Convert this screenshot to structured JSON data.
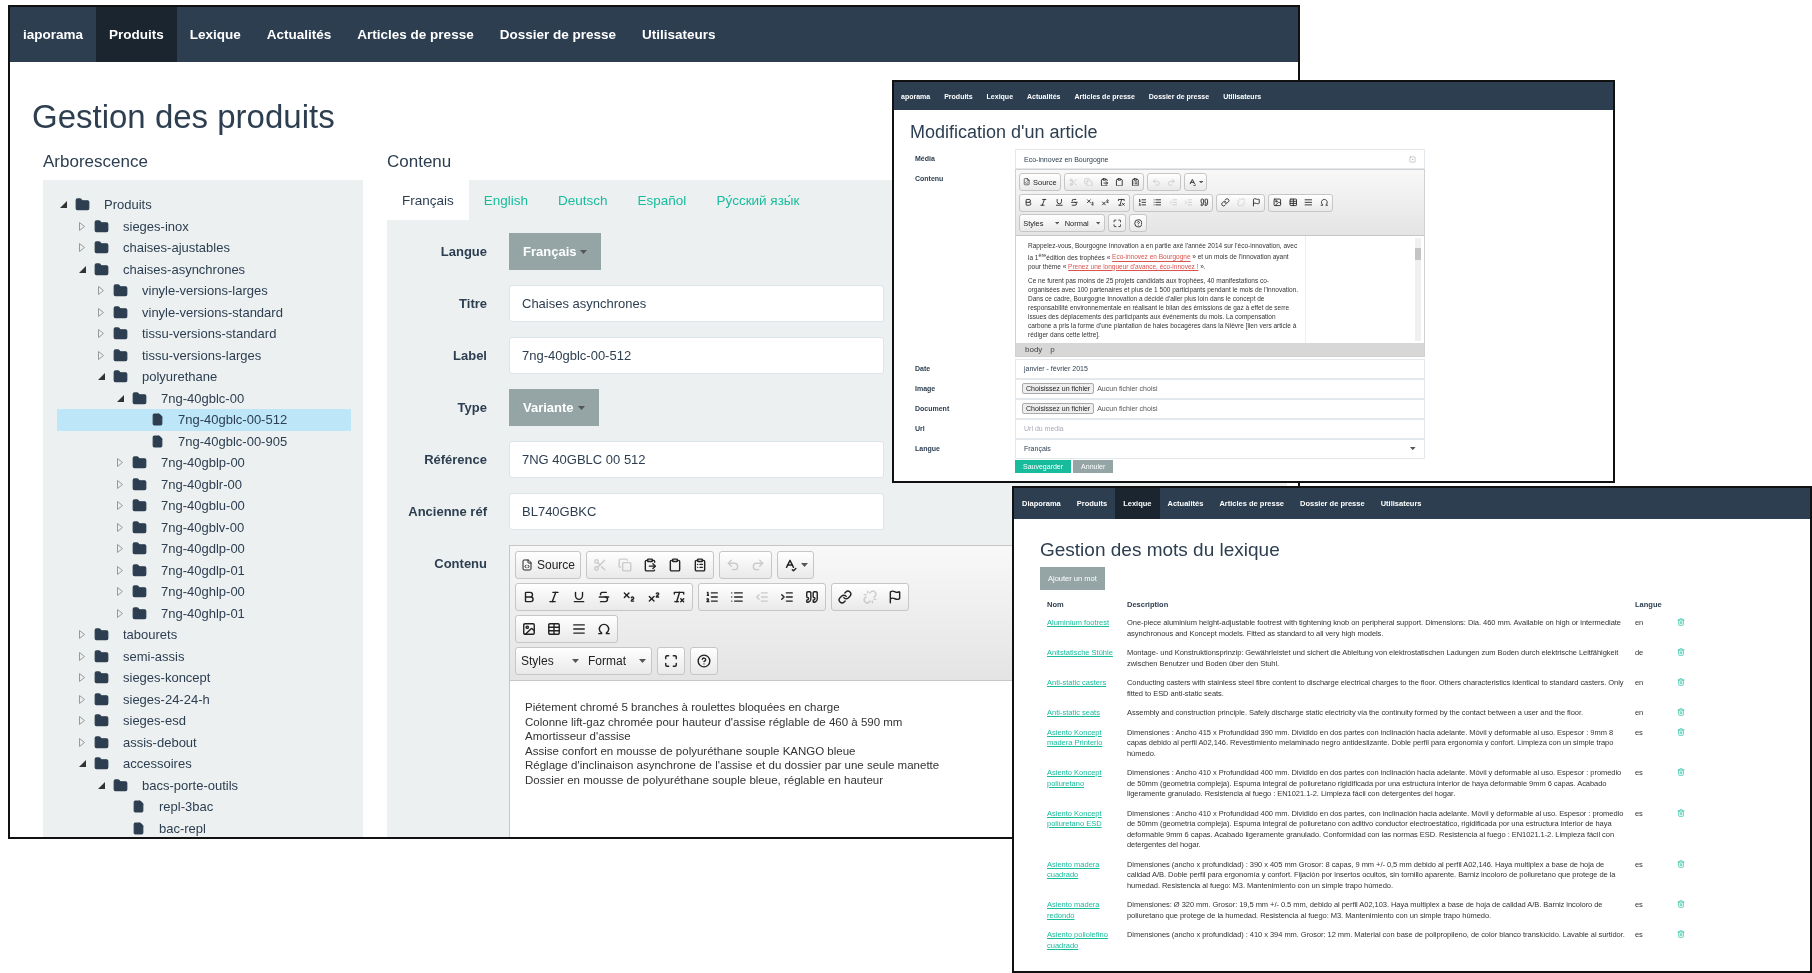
{
  "products_window": {
    "nav": [
      {
        "label": "iaporama",
        "selected": false
      },
      {
        "label": "Produits",
        "selected": true
      },
      {
        "label": "Lexique",
        "selected": false
      },
      {
        "label": "Actualités",
        "selected": false
      },
      {
        "label": "Articles de presse",
        "selected": false
      },
      {
        "label": "Dossier de presse",
        "selected": false
      },
      {
        "label": "Utilisateurs",
        "selected": false
      }
    ],
    "title": "Gestion des produits",
    "tree_heading": "Arborescence",
    "tree": [
      {
        "label": "Produits",
        "kind": "folder",
        "expanded": true,
        "selected": false,
        "children": [
          {
            "label": "sieges-inox",
            "kind": "folder",
            "expanded": false,
            "selected": false
          },
          {
            "label": "chaises-ajustables",
            "kind": "folder",
            "expanded": false,
            "selected": false
          },
          {
            "label": "chaises-asynchrones",
            "kind": "folder",
            "expanded": true,
            "selected": false,
            "children": [
              {
                "label": "vinyle-versions-larges",
                "kind": "folder",
                "expanded": false,
                "selected": false
              },
              {
                "label": "vinyle-versions-standard",
                "kind": "folder",
                "expanded": false,
                "selected": false
              },
              {
                "label": "tissu-versions-standard",
                "kind": "folder",
                "expanded": false,
                "selected": false
              },
              {
                "label": "tissu-versions-larges",
                "kind": "folder",
                "expanded": false,
                "selected": false
              },
              {
                "label": "polyurethane",
                "kind": "folder",
                "expanded": true,
                "selected": false,
                "children": [
                  {
                    "label": "7ng-40gblc-00",
                    "kind": "folder",
                    "expanded": true,
                    "selected": false,
                    "children": [
                      {
                        "label": "7ng-40gblc-00-512",
                        "kind": "file",
                        "selected": true
                      },
                      {
                        "label": "7ng-40gblc-00-905",
                        "kind": "file",
                        "selected": false
                      }
                    ]
                  },
                  {
                    "label": "7ng-40gblp-00",
                    "kind": "folder",
                    "expanded": false,
                    "selected": false
                  },
                  {
                    "label": "7ng-40gblr-00",
                    "kind": "folder",
                    "expanded": false,
                    "selected": false
                  },
                  {
                    "label": "7ng-40gblu-00",
                    "kind": "folder",
                    "expanded": false,
                    "selected": false
                  },
                  {
                    "label": "7ng-40gblv-00",
                    "kind": "folder",
                    "expanded": false,
                    "selected": false
                  },
                  {
                    "label": "7ng-40gdlp-00",
                    "kind": "folder",
                    "expanded": false,
                    "selected": false
                  },
                  {
                    "label": "7ng-40gdlp-01",
                    "kind": "folder",
                    "expanded": false,
                    "selected": false
                  },
                  {
                    "label": "7ng-40ghlp-00",
                    "kind": "folder",
                    "expanded": false,
                    "selected": false
                  },
                  {
                    "label": "7ng-40ghlp-01",
                    "kind": "folder",
                    "expanded": false,
                    "selected": false
                  }
                ]
              }
            ]
          },
          {
            "label": "tabourets",
            "kind": "folder",
            "expanded": false,
            "selected": false
          },
          {
            "label": "semi-assis",
            "kind": "folder",
            "expanded": false,
            "selected": false
          },
          {
            "label": "sieges-koncept",
            "kind": "folder",
            "expanded": false,
            "selected": false
          },
          {
            "label": "sieges-24-24-h",
            "kind": "folder",
            "expanded": false,
            "selected": false
          },
          {
            "label": "sieges-esd",
            "kind": "folder",
            "expanded": false,
            "selected": false
          },
          {
            "label": "assis-debout",
            "kind": "folder",
            "expanded": false,
            "selected": false
          },
          {
            "label": "accessoires",
            "kind": "folder",
            "expanded": true,
            "selected": false,
            "children": [
              {
                "label": "bacs-porte-outils",
                "kind": "folder",
                "expanded": true,
                "selected": false,
                "children": [
                  {
                    "label": "repl-3bac",
                    "kind": "file",
                    "selected": false
                  },
                  {
                    "label": "bac-repl",
                    "kind": "file",
                    "selected": false
                  }
                ]
              }
            ]
          }
        ]
      }
    ],
    "content_heading": "Contenu",
    "lang_tabs": [
      {
        "label": "Français",
        "selected": true
      },
      {
        "label": "English",
        "selected": false
      },
      {
        "label": "Deutsch",
        "selected": false
      },
      {
        "label": "Español",
        "selected": false
      },
      {
        "label": "Ру́сский язы́к",
        "selected": false
      }
    ],
    "fields": [
      {
        "label": "Langue",
        "kind": "dropdown",
        "value": "Français"
      },
      {
        "label": "Titre",
        "kind": "input",
        "value": "Chaises asynchrones"
      },
      {
        "label": "Label",
        "kind": "input",
        "value": "7ng-40gblc-00-512"
      },
      {
        "label": "Type",
        "kind": "dropdown",
        "value": "Variante"
      },
      {
        "label": "Référence",
        "kind": "input",
        "value": "7NG 40GBLC 00 512"
      },
      {
        "label": "Ancienne réf",
        "kind": "input",
        "value": "BL740GBKC"
      },
      {
        "label": "Contenu",
        "kind": "editor"
      }
    ],
    "editor": {
      "toolbar": [
        [
          [
            {
              "kind": "source",
              "label": "Source",
              "disabled": false
            }
          ],
          [
            {
              "kind": "cut",
              "disabled": true
            },
            {
              "kind": "copy",
              "disabled": true
            },
            {
              "kind": "paste",
              "disabled": false
            },
            {
              "kind": "paste-text",
              "disabled": false
            },
            {
              "kind": "paste-word",
              "disabled": false
            }
          ],
          [
            {
              "kind": "undo",
              "disabled": true
            },
            {
              "kind": "redo",
              "disabled": true
            }
          ],
          [
            {
              "kind": "spellcheck",
              "disabled": false
            }
          ]
        ],
        [
          [
            {
              "kind": "bold",
              "disabled": false
            },
            {
              "kind": "italic",
              "disabled": false
            },
            {
              "kind": "underline",
              "disabled": false
            },
            {
              "kind": "strike",
              "disabled": false
            },
            {
              "kind": "subscript",
              "disabled": false
            },
            {
              "kind": "superscript",
              "disabled": false
            },
            {
              "kind": "remove-format",
              "disabled": false
            }
          ],
          [
            {
              "kind": "ordered-list",
              "disabled": false
            },
            {
              "kind": "bulleted-list",
              "disabled": false
            },
            {
              "kind": "outdent",
              "disabled": true
            },
            {
              "kind": "indent",
              "disabled": false
            },
            {
              "kind": "blockquote",
              "disabled": false
            }
          ],
          [
            {
              "kind": "link",
              "disabled": false
            },
            {
              "kind": "unlink",
              "disabled": true
            },
            {
              "kind": "anchor",
              "disabled": false
            }
          ]
        ],
        [
          [
            {
              "kind": "image",
              "disabled": false
            },
            {
              "kind": "table",
              "disabled": false
            },
            {
              "kind": "horizontal-rule",
              "disabled": false
            },
            {
              "kind": "special-char",
              "disabled": false
            }
          ]
        ],
        [
          [
            {
              "kind": "combo",
              "label": "Styles",
              "disabled": false
            },
            {
              "kind": "combo",
              "label": "Format",
              "disabled": false
            }
          ],
          [
            {
              "kind": "maximize",
              "disabled": false
            }
          ],
          [
            {
              "kind": "help",
              "disabled": false
            }
          ]
        ]
      ],
      "lines": [
        "Piétement chromé 5 branches à roulettes bloquées en charge",
        "Colonne lift-gaz chromée pour hauteur d'assise réglable de 460 à 590 mm",
        "Amortisseur d'assise",
        "Assise confort en mousse de polyuréthane souple KANGO bleue",
        "Réglage d'inclinaison asynchrone de l'assise et du dossier par une seule manette",
        "Dossier en mousse de polyuréthane souple bleue, réglable en hauteur"
      ]
    }
  },
  "article_window": {
    "nav": [
      {
        "label": "aporama",
        "selected": false
      },
      {
        "label": "Produits",
        "selected": false
      },
      {
        "label": "Lexique",
        "selected": false
      },
      {
        "label": "Actualités",
        "selected": false
      },
      {
        "label": "Articles de presse",
        "selected": false
      },
      {
        "label": "Dossier de presse",
        "selected": false
      },
      {
        "label": "Utilisateurs",
        "selected": false
      }
    ],
    "title": "Modification d'un article",
    "rows": [
      {
        "label": "Média",
        "kind": "input",
        "value": "Eco-innovez en Bourgogne"
      },
      {
        "label": "Contenu",
        "kind": "editor"
      },
      {
        "label": "Date",
        "kind": "input",
        "value": "janvier - février 2015"
      },
      {
        "label": "Image",
        "kind": "file",
        "button": "Choisissez un fichier",
        "value": "Aucun fichier choisi"
      },
      {
        "label": "Document",
        "kind": "file",
        "button": "Choisissez un fichier",
        "value": "Aucun fichier choisi"
      },
      {
        "label": "Url",
        "kind": "input",
        "placeholder": "Url du media"
      },
      {
        "label": "Langue",
        "kind": "select",
        "value": "Français"
      }
    ],
    "editor": {
      "toolbar": [
        [
          [
            {
              "kind": "source",
              "label": "Source",
              "disabled": false
            }
          ],
          [
            {
              "kind": "cut",
              "disabled": true
            },
            {
              "kind": "copy",
              "disabled": true
            },
            {
              "kind": "paste",
              "disabled": false
            },
            {
              "kind": "paste-text",
              "disabled": false
            },
            {
              "kind": "paste-word",
              "disabled": false
            }
          ],
          [
            {
              "kind": "undo",
              "disabled": true
            },
            {
              "kind": "redo",
              "disabled": true
            }
          ],
          [
            {
              "kind": "spellcheck",
              "disabled": false
            }
          ]
        ],
        [
          [
            {
              "kind": "bold",
              "disabled": false
            },
            {
              "kind": "italic",
              "disabled": false
            },
            {
              "kind": "underline",
              "disabled": false
            },
            {
              "kind": "strike",
              "disabled": false
            },
            {
              "kind": "subscript",
              "disabled": false
            },
            {
              "kind": "superscript",
              "disabled": false
            },
            {
              "kind": "remove-format",
              "disabled": false
            }
          ],
          [
            {
              "kind": "ordered-list",
              "disabled": false
            },
            {
              "kind": "bulleted-list",
              "disabled": false
            },
            {
              "kind": "outdent",
              "disabled": true
            },
            {
              "kind": "indent",
              "disabled": true
            },
            {
              "kind": "blockquote",
              "disabled": false
            }
          ],
          [
            {
              "kind": "link",
              "disabled": false
            },
            {
              "kind": "unlink",
              "disabled": true
            },
            {
              "kind": "anchor",
              "disabled": false
            }
          ],
          [
            {
              "kind": "image",
              "disabled": false
            },
            {
              "kind": "table",
              "disabled": false
            },
            {
              "kind": "horizontal-rule",
              "disabled": false
            },
            {
              "kind": "special-char",
              "disabled": false
            }
          ]
        ],
        [
          [
            {
              "kind": "combo",
              "label": "Styles",
              "disabled": false
            },
            {
              "kind": "combo",
              "label": "Normal",
              "disabled": false
            }
          ],
          [
            {
              "kind": "maximize",
              "disabled": false
            }
          ],
          [
            {
              "kind": "help",
              "disabled": false
            }
          ]
        ]
      ],
      "paragraphs": [
        [
          {
            "kind": "text",
            "text": "Rappelez-vous, Bourgogne Innovation a en partie axé l'année 2014 sur l'éco-innovation, avec la 1$^{ère}$édition des trophées « "
          },
          {
            "kind": "link",
            "text": "Eco-innovez en Bourgogne"
          },
          {
            "kind": "text",
            "text": " » et un mois de l'innovation ayant pour thème « "
          },
          {
            "kind": "link",
            "text": "Prenez une longueur d'avance, éco-innovez !"
          },
          {
            "kind": "text",
            "text": " »."
          }
        ],
        [
          {
            "kind": "text",
            "text": "Ce ne furent pas moins de 25 projets candidats aux trophées, 40 manifestations co-organisées avec 100 partenaires et plus de 1 500 participants pendant le mois de l'innovation. Dans ce cadre, Bourgogne Innovation a décidé d'aller plus loin dans le concept de responsabilité environnementale en réalisant le bilan des émissions de gaz à effet de serre issues des déplacements des participants aux événements du mois. La compensation carbone a pris la forme d'une plantation de haies bocagères dans la Nièvre [lien vers article à rédiger dans cette lettre]."
          }
        ]
      ],
      "path": [
        "body",
        "p"
      ]
    },
    "buttons": [
      {
        "label": "Sauvegarder",
        "kind": "primary"
      },
      {
        "label": "Annuler",
        "kind": "secondary"
      }
    ]
  },
  "lexicon_window": {
    "nav": [
      {
        "label": "Diaporama",
        "selected": false
      },
      {
        "label": "Produits",
        "selected": false
      },
      {
        "label": "Lexique",
        "selected": true
      },
      {
        "label": "Actualités",
        "selected": false
      },
      {
        "label": "Articles de presse",
        "selected": false
      },
      {
        "label": "Dossier de presse",
        "selected": false
      },
      {
        "label": "Utilisateurs",
        "selected": false
      }
    ],
    "title": "Gestion des mots du lexique",
    "add_button": "Ajouter un mot",
    "columns": [
      "Nom",
      "Description",
      "Langue"
    ],
    "rows": [
      {
        "name": "Aluminium footrest",
        "description": "One-piece aluminium height-adjustable footrest with tightening knob on peripheral support. Dimensions: Dia. 460 mm. Available on high or intermediate asynchronous and Koncept models. Fitted as standard to all very high models.",
        "lang": "en"
      },
      {
        "name": "Anitstatische Stühle",
        "description": "Montage- und Konstruktionsprinzip: Gewährleistet und sichert die Ableitung von elektrostatischen Ladungen zum Boden durch elektrische Leitfähigkeit zwischen Benutzer und Boden über den Stuhl.",
        "lang": "de"
      },
      {
        "name": "Anti-static casters",
        "description": "Conducting casters with stainless steel fibre content to discharge electrical charges to the floor. Others characteristics identical to standard casters. Only fitted to ESD anti-static seats.",
        "lang": "en"
      },
      {
        "name": "Anti-static seats",
        "description": "Assembly and construction principle. Safely discharge static electricity via the continuity formed by the contact between a user and the floor.",
        "lang": "en"
      },
      {
        "name": "Asiento Koncept madera Printerio",
        "description": "Dimensiones : Ancho 415 x Profundidad 390 mm. Dividido en dos partes con inclinación hacia adelante. Móvil y deformable al uso. Espesor : 9mm 8 capas debido al perfil A02,146. Revestimiento melaminado negro antideslizante. Doble perfil para ergonomia y confort. Limpieza con un simple trapo húmedo.",
        "lang": "es"
      },
      {
        "name": "Asiento Koncept poliuretano",
        "description": "Dimensiones : Ancho 410 x Profundidad 400 mm. Dividido en dos partes con inclinación hacia adelante. Móvil y deformable al uso. Espesor : promedio de 50mm (geometria compleja). Espuma integral de poliuretano rigidificada por una estructura interior de haya deformable 9mm 6 capas. Acabado ligeramente granulado. Resistencia al fuego : EN1021.1-2. Limpieza fácil con detergentes del hogar.",
        "lang": "es"
      },
      {
        "name": "Asiento Koncept poliuretano ESD",
        "description": "Dimensiones : Ancho 410 x Profundidad 400 mm. Dividido en dos partes, con inclinación hacia adelante. Móvil y deformable al uso. Espesor : promedio de 50mm (geometria compleja). Espuma integral de poliuretano con aditivo conductor electroestático, rigidificada por una estructura interior de haya deformable 9mm 6 capas. Acabado ligeramente granulado. Conformidad con las normas ESD. Resistencia al fuego : EN1021.1-2. Limpieza fácil con detergentes del hogar.",
        "lang": "es"
      },
      {
        "name": "Asiento madera cuadrado",
        "description": "Dimensiones (ancho x profundidad) : 390 x 405 mm Grosor: 8 capas, 9 mm +/- 0,5 mm debido al perfil A02,146. Haya multiplex a base de hoja de calidad A/B. Doble perfil para ergonomía y confort. Fijación por insertos ocultos, sin tornillo aparente. Barniz incoloro de poliuretano que protege de la humedad. Resistencia al fuego: M3. Mantenimiento con un simple trapo húmedo.",
        "lang": "es"
      },
      {
        "name": "Asiento madera redondo",
        "description": "Dimensiones: Ø 320 mm. Grosor: 19,5 mm +/- 0.5 mm, debido al perfil A02,103. Haya multiplex a base de hoja de calidad A/B. Barniz incoloro de poliuretano que protege de la humedad. Resistencia al fuego: M3. Mantenimiento con un simple trapo húmedo.",
        "lang": "es"
      },
      {
        "name": "Asiento poliolefino cuadrado",
        "description": "Dimensiones (ancho x profundidad) : 410 x 394 mm. Grosor: 12 mm. Material con base de polipropileno, de color blanco translúcido. Lavable al surtidor.",
        "lang": "es"
      }
    ]
  }
}
